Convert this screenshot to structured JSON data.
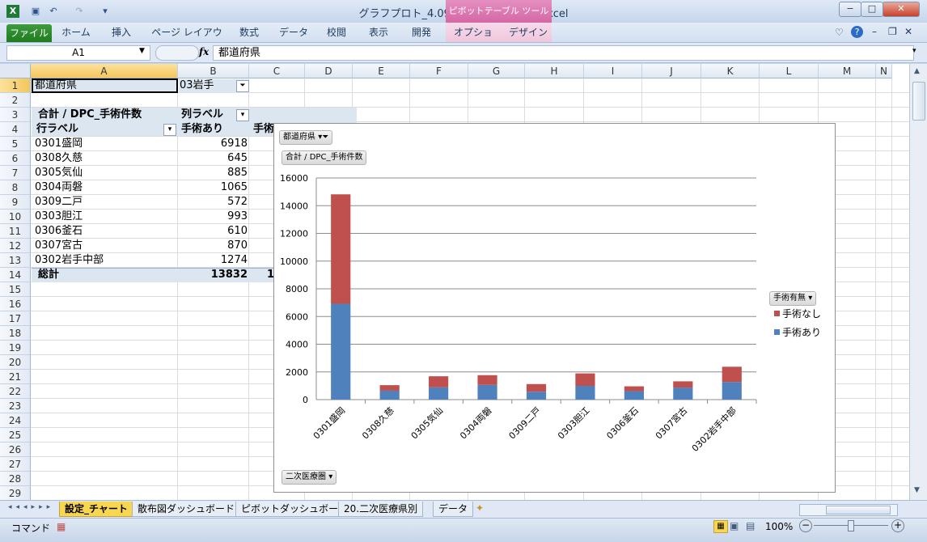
{
  "window": {
    "title": "グラフプロト_4.09.xlsm - Microsoft Excel",
    "contextual_tab": "ピボットテーブル ツール",
    "minimize": "−",
    "maximize": "□",
    "close": "✕"
  },
  "ribbon": {
    "file": "ファイル",
    "tabs": [
      "ホーム",
      "挿入",
      "ページ レイアウト",
      "数式",
      "データ",
      "校閲",
      "表示",
      "開発",
      "オプション",
      "デザイン"
    ]
  },
  "formula_bar": {
    "name_box": "A1",
    "fx": "fx",
    "value": "都道府県"
  },
  "columns": [
    "A",
    "B",
    "C",
    "D",
    "E",
    "F",
    "G",
    "H",
    "I",
    "J",
    "K",
    "L",
    "M",
    "N"
  ],
  "rows": [
    "1",
    "2",
    "3",
    "4",
    "5",
    "6",
    "7",
    "8",
    "9",
    "10",
    "11",
    "12",
    "13",
    "14",
    "15",
    "16",
    "17",
    "18",
    "19",
    "20",
    "21",
    "22",
    "23",
    "24",
    "25",
    "26",
    "27",
    "28",
    "29"
  ],
  "pivot": {
    "filter_label": "都道府県",
    "filter_value": "03岩手",
    "sum_label": "合計 / DPC_手術件数",
    "col_label": "列ラベル",
    "row_label": "行ラベル",
    "col1": "手術あり",
    "col2_partial": "手術",
    "rows": [
      {
        "name": "0301盛岡",
        "value": "6918"
      },
      {
        "name": "0308久慈",
        "value": "645"
      },
      {
        "name": "0305気仙",
        "value": "885"
      },
      {
        "name": "0304両磐",
        "value": "1065"
      },
      {
        "name": "0309二戸",
        "value": "572"
      },
      {
        "name": "0303胆江",
        "value": "993"
      },
      {
        "name": "0306釜石",
        "value": "610"
      },
      {
        "name": "0307宮古",
        "value": "870"
      },
      {
        "name": "0302岩手中部",
        "value": "1274"
      }
    ],
    "total_label": "総計",
    "total_value": "13832",
    "total_partial": "1"
  },
  "chart_filter_buttons": {
    "prefecture": "都道府県",
    "value_field": "合計 / DPC_手術件数",
    "legend_field": "手術有無",
    "axis_field": "二次医療圏"
  },
  "chart_data": {
    "type": "bar",
    "stacked": true,
    "categories": [
      "0301盛岡",
      "0308久慈",
      "0305気仙",
      "0304両磐",
      "0309二戸",
      "0303胆江",
      "0306釜石",
      "0307宮古",
      "0302岩手中部"
    ],
    "series": [
      {
        "name": "手術あり",
        "color": "#4f81bd",
        "values": [
          6918,
          645,
          885,
          1065,
          572,
          993,
          610,
          870,
          1274
        ]
      },
      {
        "name": "手術なし",
        "color": "#c0504d",
        "values": [
          7900,
          400,
          800,
          700,
          550,
          900,
          350,
          450,
          1100
        ]
      }
    ],
    "ylim": [
      0,
      16000
    ],
    "yticks": [
      0,
      2000,
      4000,
      6000,
      8000,
      10000,
      12000,
      14000,
      16000
    ],
    "legend_position": "right",
    "grid": true
  },
  "sheet_tabs": [
    "設定_チャート",
    "散布図ダッシュボード",
    "ピボットダッシュボード",
    "20.二次医療県別",
    "データ"
  ],
  "active_sheet": "設定_チャート",
  "status": {
    "mode": "コマンド",
    "zoom": "100%"
  }
}
